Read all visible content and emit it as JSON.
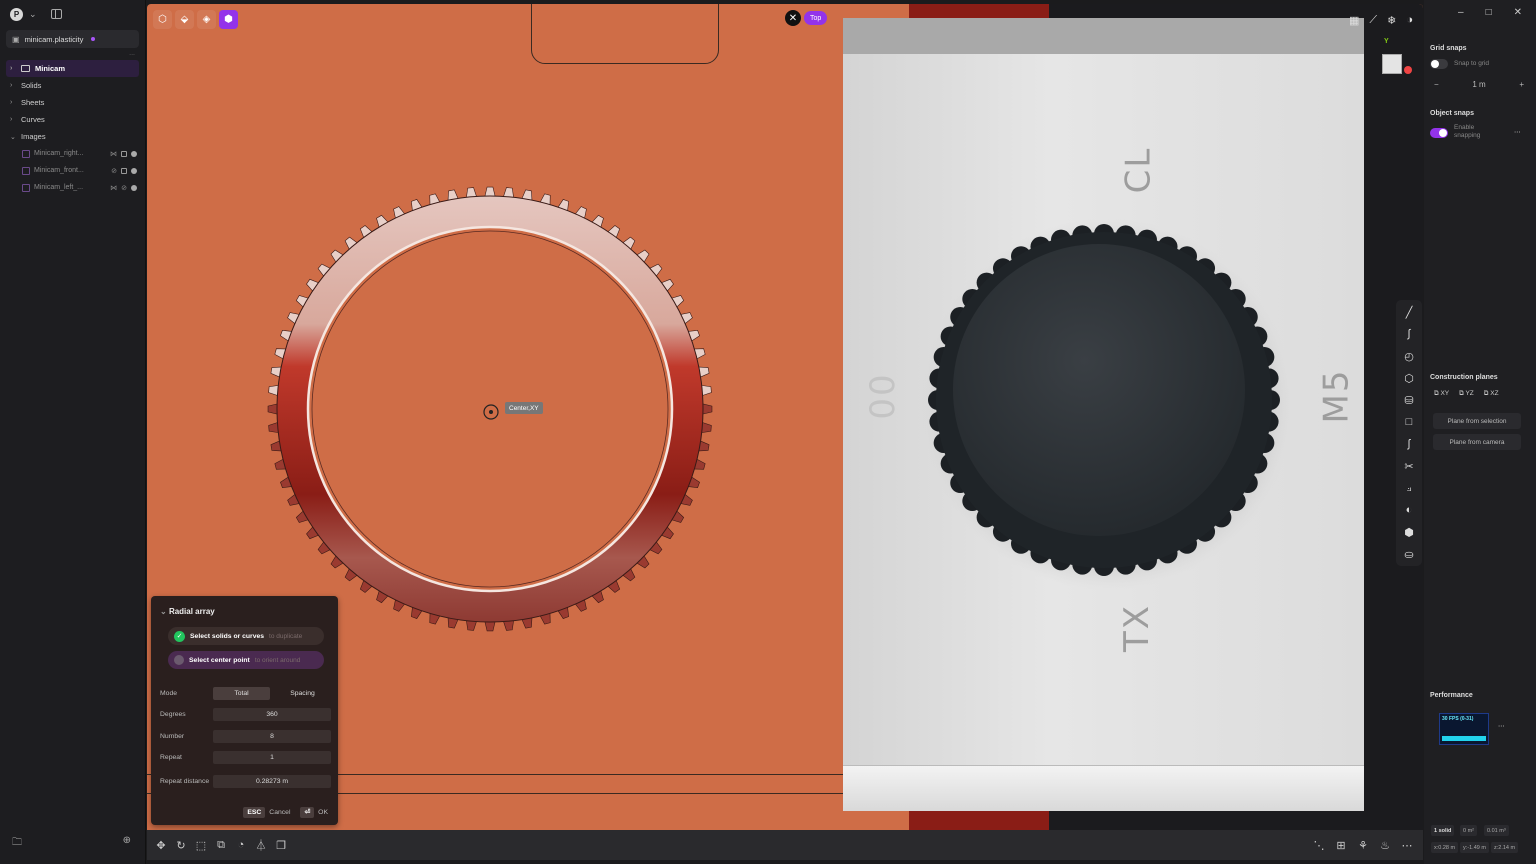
{
  "sidebar": {
    "logo_letter": "P",
    "file_name": "minicam.plasticity",
    "more": "...",
    "tree": [
      {
        "label": "Minicam",
        "arrow": "›"
      },
      {
        "label": "Solids",
        "arrow": "›"
      },
      {
        "label": "Sheets",
        "arrow": "›"
      },
      {
        "label": "Curves",
        "arrow": "›"
      },
      {
        "label": "Images",
        "arrow": "⌄"
      }
    ],
    "images": [
      "Minicam_right...",
      "Minicam_front...",
      "Minicam_left_..."
    ]
  },
  "viewport": {
    "view_label": "Top",
    "snap_label": "Center,XY",
    "photo_text": {
      "cl": "CL",
      "m5": "M5",
      "tx": "TX",
      "oo": "00"
    }
  },
  "dialog": {
    "title": "Radial array",
    "step1_label": "Select solids or curves",
    "step1_hint": "to duplicate",
    "step2_label": "Select center point",
    "step2_hint": "to orient around",
    "mode_label": "Mode",
    "mode_total": "Total",
    "mode_spacing": "Spacing",
    "degrees_label": "Degrees",
    "degrees_value": "360",
    "number_label": "Number",
    "number_value": "8",
    "repeat_label": "Repeat",
    "repeat_value": "1",
    "repeat_distance_label": "Repeat distance",
    "repeat_distance_value": "0.28273 m",
    "esc_key": "ESC",
    "cancel": "Cancel",
    "ok_key": "⏎",
    "ok": "OK"
  },
  "rpanel": {
    "grid_snaps": "Grid snaps",
    "snap_to_grid": "Snap to grid",
    "grid_value": "1 m",
    "object_snaps": "Object snaps",
    "enable_snapping": "Enable snapping",
    "construction_planes": "Construction planes",
    "planes": [
      "XY",
      "YZ",
      "XZ"
    ],
    "plane_from_selection": "Plane from selection",
    "plane_from_camera": "Plane from camera",
    "performance": "Performance",
    "fps": "30 FPS (0-31)",
    "stats": [
      "1 solid",
      "0 m²",
      "0.01 m³",
      "x:0.28 m",
      "y:-1.49 m",
      "z:2.14 m"
    ]
  },
  "colors": {
    "accent": "#9333ea",
    "viewport": "#cf6d47",
    "ring": "#8a1d16"
  }
}
